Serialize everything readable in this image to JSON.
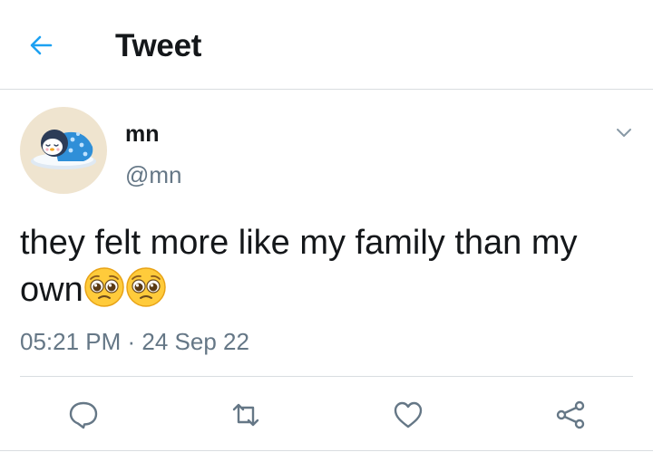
{
  "header": {
    "title": "Tweet",
    "back_icon": "arrow-left-icon",
    "accent": "#1da1f2"
  },
  "tweet": {
    "display_name": "mn",
    "handle": "@mn",
    "avatar_icon": "sleeping-penguin-avatar",
    "text": "they felt more like my family than my own",
    "emojis": [
      "pleading-face-emoji",
      "pleading-face-emoji"
    ],
    "timestamp": "05:21 PM · 24 Sep 22"
  },
  "actions": [
    {
      "name": "reply",
      "icon": "reply-icon"
    },
    {
      "name": "retweet",
      "icon": "retweet-icon"
    },
    {
      "name": "like",
      "icon": "heart-icon"
    },
    {
      "name": "share",
      "icon": "share-icon"
    }
  ],
  "colors": {
    "text": "#14171a",
    "secondary": "#657786",
    "divider": "#d9dde0"
  }
}
